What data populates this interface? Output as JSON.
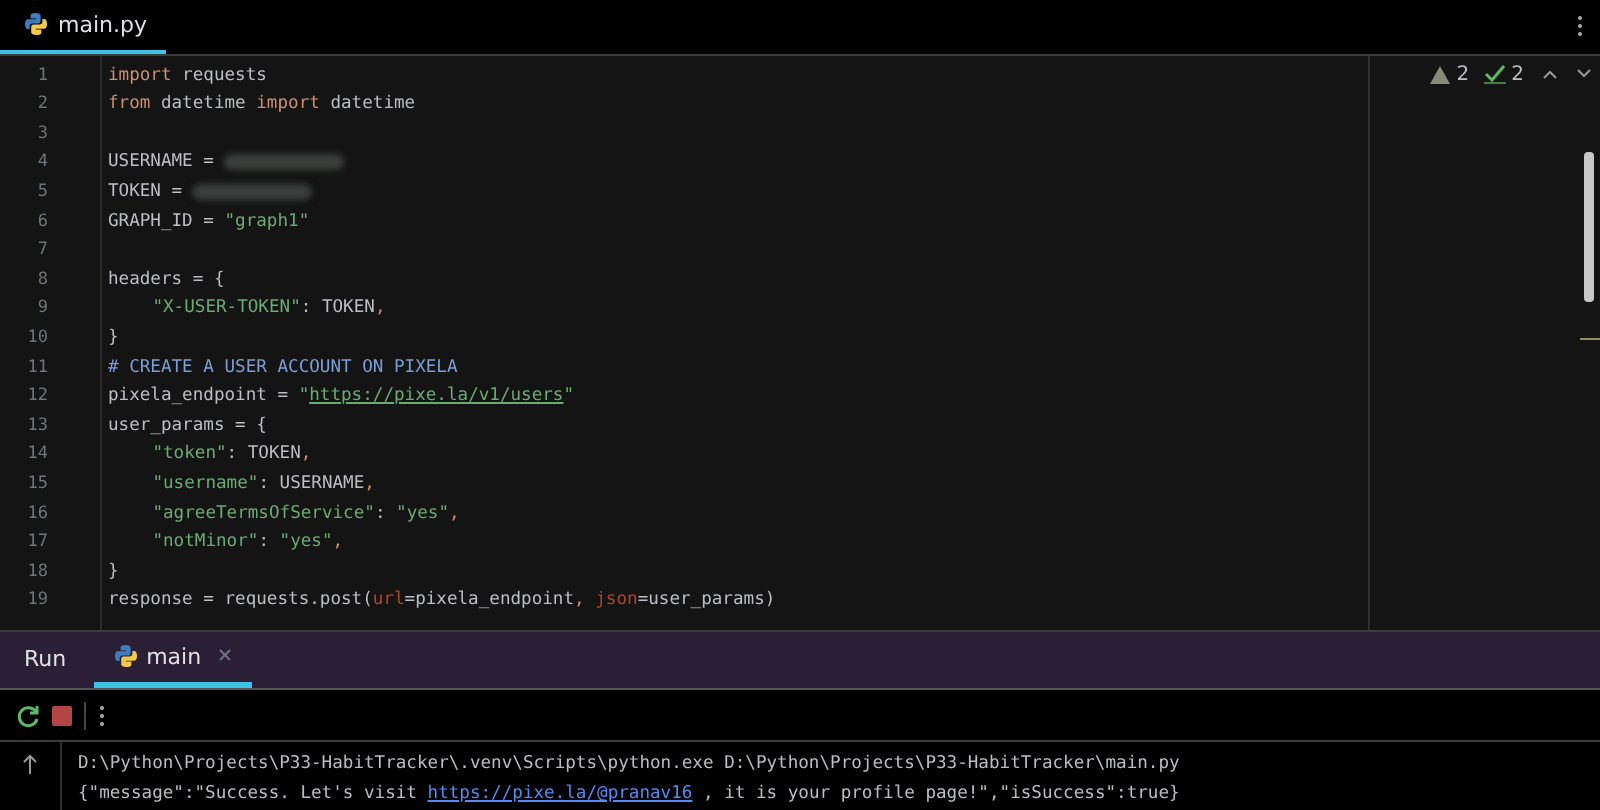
{
  "editor_tabs": [
    {
      "label": "main.py",
      "selected": true
    }
  ],
  "inspections": {
    "warnings": "2",
    "passed": "2"
  },
  "code_lines": [
    {
      "number": "1",
      "segments": [
        {
          "kind": "keyword",
          "text": "import"
        },
        {
          "kind": "plain",
          "text": " requests"
        }
      ]
    },
    {
      "number": "2",
      "segments": [
        {
          "kind": "keyword",
          "text": "from"
        },
        {
          "kind": "plain",
          "text": " datetime "
        },
        {
          "kind": "keyword",
          "text": "import"
        },
        {
          "kind": "plain",
          "text": " datetime"
        }
      ]
    },
    {
      "number": "3"
    },
    {
      "number": "4",
      "segments": [
        {
          "kind": "plain",
          "text": "USERNAME = "
        },
        {
          "kind": "redacted"
        }
      ]
    },
    {
      "number": "5",
      "segments": [
        {
          "kind": "plain",
          "text": "TOKEN = "
        },
        {
          "kind": "redacted"
        }
      ]
    },
    {
      "number": "6",
      "segments": [
        {
          "kind": "plain",
          "text": "GRAPH_ID = "
        },
        {
          "kind": "string",
          "text": "\"graph1\""
        }
      ]
    },
    {
      "number": "7"
    },
    {
      "number": "8",
      "segments": [
        {
          "kind": "plain",
          "text": "headers = {"
        }
      ]
    },
    {
      "number": "9",
      "indented": true,
      "segments": [
        {
          "kind": "string",
          "text": "\"X-USER-TOKEN\""
        },
        {
          "kind": "plain",
          "text": ": TOKEN"
        },
        {
          "kind": "keyword",
          "text": ","
        }
      ]
    },
    {
      "number": "10",
      "segments": [
        {
          "kind": "plain",
          "text": "}"
        }
      ]
    },
    {
      "number": "11",
      "segments": [
        {
          "kind": "comment",
          "text": "# CREATE A USER ACCOUNT ON PIXELA"
        }
      ]
    },
    {
      "number": "12",
      "segments": [
        {
          "kind": "plain",
          "text": "pixela_endpoint = "
        },
        {
          "kind": "string",
          "text": "\""
        },
        {
          "kind": "link",
          "text": "https://pixe.la/v1/users"
        },
        {
          "kind": "string",
          "text": "\""
        }
      ]
    },
    {
      "number": "13",
      "segments": [
        {
          "kind": "plain",
          "text": "user_params = {"
        }
      ]
    },
    {
      "number": "14",
      "indented": true,
      "segments": [
        {
          "kind": "string",
          "text": "\"token\""
        },
        {
          "kind": "plain",
          "text": ": TOKEN"
        },
        {
          "kind": "keyword",
          "text": ","
        }
      ]
    },
    {
      "number": "15",
      "indented": true,
      "segments": [
        {
          "kind": "string",
          "text": "\"username\""
        },
        {
          "kind": "plain",
          "text": ": USERNAME"
        },
        {
          "kind": "keyword",
          "text": ","
        }
      ]
    },
    {
      "number": "16",
      "indented": true,
      "segments": [
        {
          "kind": "string",
          "text": "\"agreeTermsOfService\""
        },
        {
          "kind": "plain",
          "text": ": "
        },
        {
          "kind": "string",
          "text": "\"yes\""
        },
        {
          "kind": "keyword",
          "text": ","
        }
      ]
    },
    {
      "number": "17",
      "indented": true,
      "segments": [
        {
          "kind": "string",
          "text": "\"notMinor\""
        },
        {
          "kind": "plain",
          "text": ": "
        },
        {
          "kind": "string",
          "text": "\"yes\""
        },
        {
          "kind": "keyword",
          "text": ","
        }
      ]
    },
    {
      "number": "18",
      "segments": [
        {
          "kind": "plain",
          "text": "}"
        }
      ]
    },
    {
      "number": "19",
      "segments": [
        {
          "kind": "plain",
          "text": "response = requests.post("
        },
        {
          "kind": "param",
          "text": "url"
        },
        {
          "kind": "plain",
          "text": "=pixela_endpoint"
        },
        {
          "kind": "keyword",
          "text": ", "
        },
        {
          "kind": "param",
          "text": "json"
        },
        {
          "kind": "plain",
          "text": "=user_params)"
        }
      ]
    }
  ],
  "run_panel": {
    "title": "Run",
    "tabs": [
      {
        "label": "main",
        "selected": true
      }
    ]
  },
  "console_lines": [
    {
      "segments": [
        {
          "kind": "plain",
          "text": "D:\\Python\\Projects\\P33-HabitTracker\\.venv\\Scripts\\python.exe D:\\Python\\Projects\\P33-HabitTracker\\main.py"
        }
      ]
    },
    {
      "segments": [
        {
          "kind": "plain",
          "text": "{\"message\":\"Success. Let's visit "
        },
        {
          "kind": "link",
          "text": "https://pixe.la/@pranav16"
        },
        {
          "kind": "plain",
          "text": " , it is your profile page!\",\"isSuccess\":true}"
        }
      ]
    }
  ]
}
